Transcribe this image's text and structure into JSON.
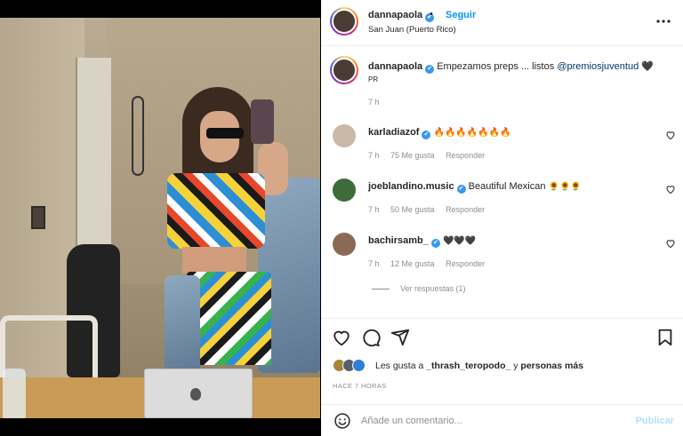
{
  "post": {
    "username": "dannapaola",
    "verified_mark": "✔",
    "follow_sep": "•",
    "follow_label": "Seguir",
    "location": "San Juan (Puerto Rico)",
    "more_label": "•••"
  },
  "caption": {
    "username": "dannapaola",
    "text": "Empezamos preps ... listos",
    "mention": "@premiosjuventud",
    "emoji": "🖤",
    "subtext": "PR",
    "time": "7 h"
  },
  "comments": [
    {
      "username": "karladiazof",
      "text": "🔥🔥🔥🔥🔥🔥🔥",
      "time": "7 h",
      "likes": "75 Me gusta",
      "reply": "Responder",
      "avatar_color": "#c8b9a8"
    },
    {
      "username": "joeblandino.music",
      "text": "Beautiful Mexican",
      "emoji": "🌻🌻🌻",
      "time": "7 h",
      "likes": "50 Me gusta",
      "reply": "Responder",
      "avatar_color": "#3f6a3a"
    },
    {
      "username": "bachirsamb_",
      "text": "🖤🖤🖤",
      "time": "7 h",
      "likes": "12 Me gusta",
      "reply": "Responder",
      "avatar_color": "#8b6a55"
    }
  ],
  "view_replies": "Ver respuestas (1)",
  "likes": {
    "prefix": "Les gusta a",
    "user": "_thrash_teropodo_",
    "middle": "y",
    "suffix": "personas más"
  },
  "posted_ago": "HACE 7 HORAS",
  "add_comment": {
    "placeholder": "Añade un comentario...",
    "publish": "Publicar"
  },
  "colors": {
    "accent": "#0095f6",
    "publish_disabled": "#b2dffc",
    "verified": "#3897f0"
  },
  "icons": [
    "heart-icon",
    "comment-icon",
    "share-icon",
    "bookmark-icon",
    "emoji-icon",
    "more-icon",
    "verified-icon"
  ]
}
